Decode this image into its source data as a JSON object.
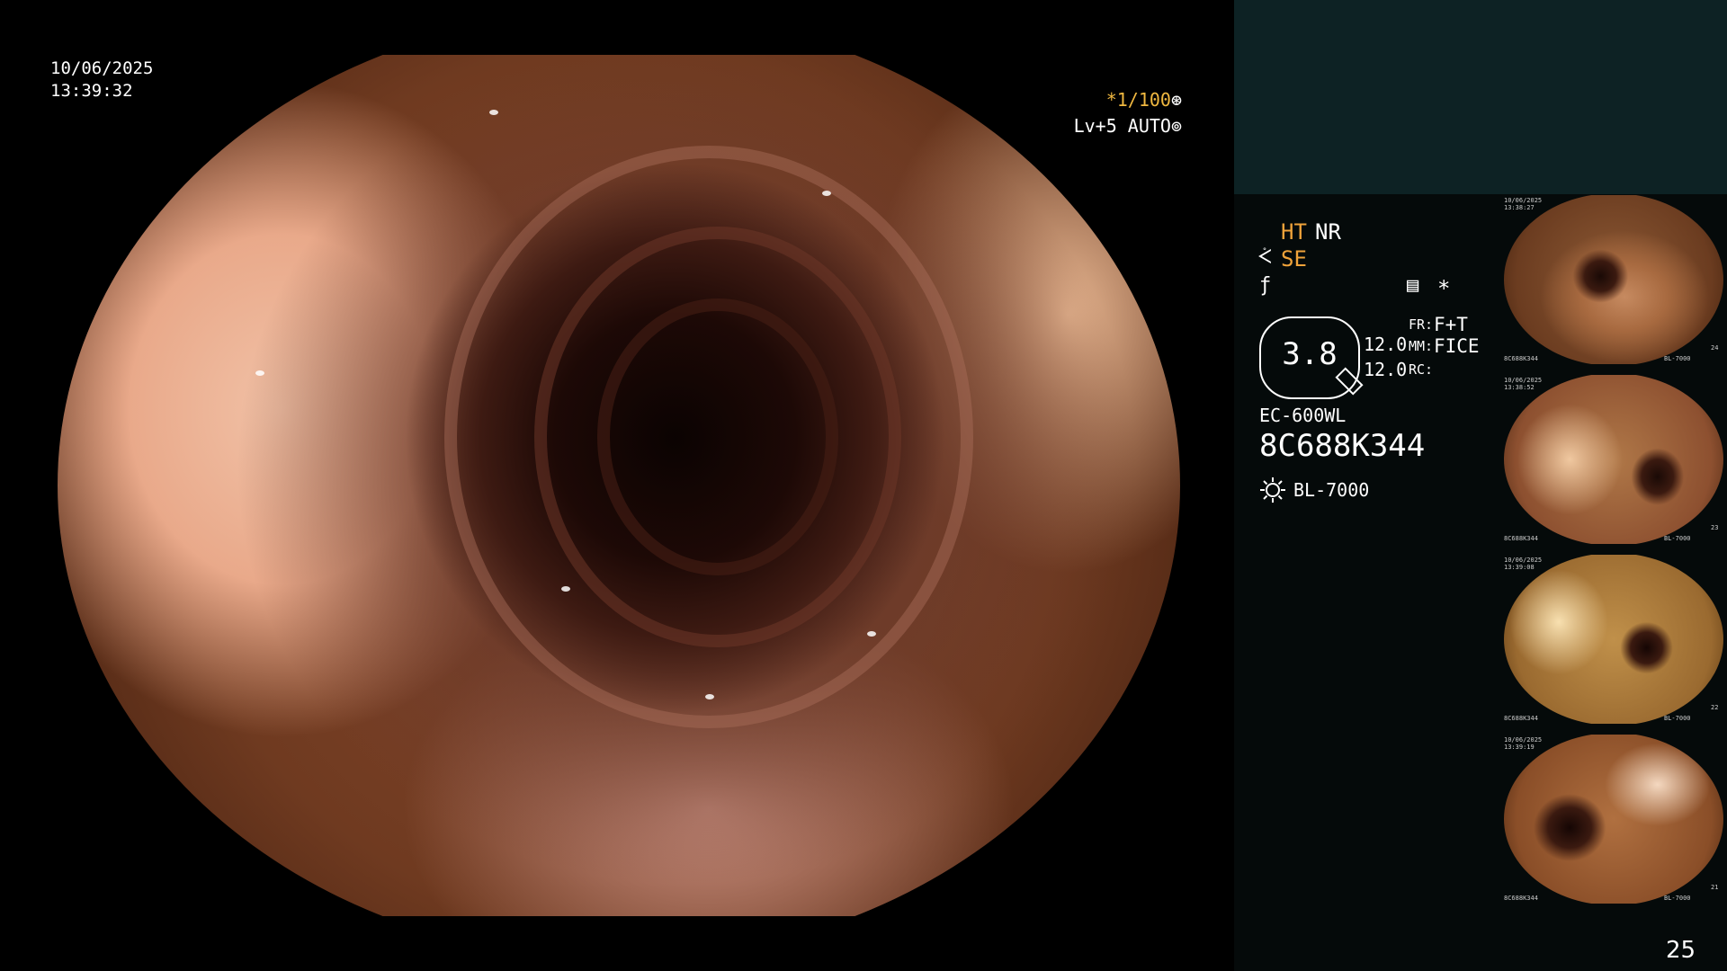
{
  "overlay": {
    "date": "10/06/2025",
    "time": "13:39:32",
    "shutter": "*1/100",
    "shutter_icon": "⊛",
    "level": "Lv+5 AUTO",
    "level_icon": "⊚"
  },
  "panel": {
    "ht": "HT",
    "nr": "NR",
    "se_symbol": "ᢵ",
    "se": "SE",
    "f_symbol": "ƒ",
    "memo_icon": "▤",
    "star": "*",
    "zoom_value": "3.8",
    "num1": "12.0",
    "num2": "12.0",
    "fr_label": "FR:",
    "fr_value": "F+T",
    "mm_label": "MM:",
    "mm_value": "FICE",
    "rc_label": "RC:",
    "model": "EC-600WL",
    "serial": "8C688K344",
    "lamp": "BL-7000"
  },
  "thumbnails": [
    {
      "date": "10/06/2025",
      "time": "13:38:27",
      "serial": "8C688K344",
      "lamp": "BL-7000",
      "num": "24"
    },
    {
      "date": "10/06/2025",
      "time": "13:38:52",
      "serial": "8C688K344",
      "lamp": "BL-7000",
      "num": "23"
    },
    {
      "date": "10/06/2025",
      "time": "13:39:08",
      "serial": "8C688K344",
      "lamp": "BL-7000",
      "num": "22"
    },
    {
      "date": "10/06/2025",
      "time": "13:39:19",
      "serial": "8C688K344",
      "lamp": "BL-7000",
      "num": "21"
    }
  ],
  "page_number": "25",
  "colors": {
    "accent_orange": "#f0a33a",
    "panel_top": "#0d2224",
    "panel_bg": "#050a0a"
  }
}
